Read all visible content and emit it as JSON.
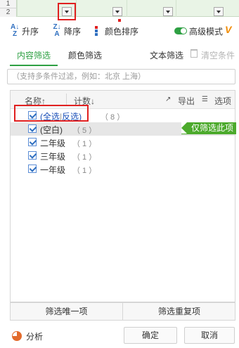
{
  "sheet": {
    "row_numbers": [
      "1",
      "2"
    ]
  },
  "toolbar": {
    "sort_asc_label": "升序",
    "sort_desc_label": "降序",
    "color_sort_label": "颜色排序",
    "advanced_mode_label": "高级模式",
    "advanced_mode_on": true,
    "accent_color": "#2ea043"
  },
  "tabs": {
    "content_filter": "内容筛选",
    "color_filter": "颜色筛选",
    "text_filter": "文本筛选",
    "clear_conditions": "清空条件"
  },
  "search": {
    "placeholder": "（支持多条件过滤，例如：北京 上海）"
  },
  "list": {
    "header": {
      "name": "名称↑",
      "count": "计数↓",
      "export": "导出",
      "options": "选项"
    },
    "select_all": "(全选",
    "invert": "反选)",
    "select_all_count": "（ 8 ）",
    "items": [
      {
        "label": "(空白)",
        "count": "（ 5 ）",
        "checked": true
      },
      {
        "label": "二年级",
        "count": "（ 1 ）",
        "checked": true
      },
      {
        "label": "三年级",
        "count": "（ 1 ）",
        "checked": true
      },
      {
        "label": "一年级",
        "count": "（ 1 ）",
        "checked": true
      }
    ],
    "only_filter_this": "仅筛选此项"
  },
  "actions": {
    "unique": "筛选唯一项",
    "duplicate": "筛选重复项"
  },
  "footer": {
    "analysis": "分析",
    "ok": "确定",
    "cancel": "取消"
  }
}
